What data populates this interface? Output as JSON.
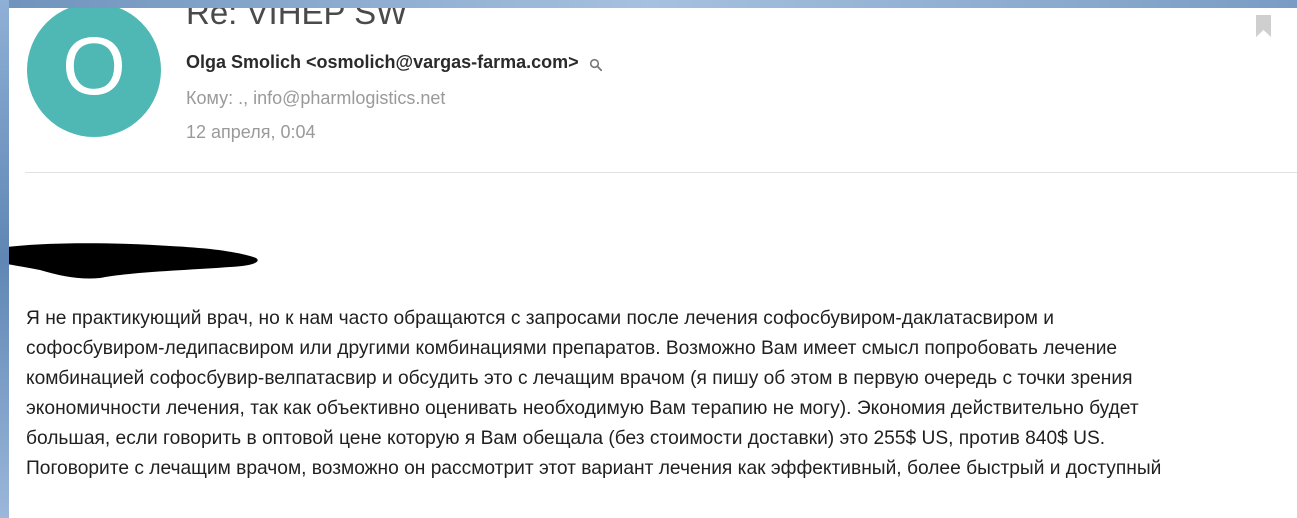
{
  "email": {
    "avatar_letter": "O",
    "subject": "Re: VIHEP SW",
    "sender": "Olga Smolich <osmolich@vargas-farma.com>",
    "to": "Кому: ., info@pharmlogistics.net",
    "date": "12 апреля, 0:04",
    "body_lines": [
      "Я не практикующий врач, но к нам часто обращаются с запросами после лечения софосбувиром-даклатасвиром и",
      "софосбувиром-ледипасвиром или другими комбинациями препаратов. Возможно Вам имеет смысл попробовать лечение",
      "комбинацией софосбувир-велпатасвир и обсудить это с лечащим врачом (я пишу об этом в первую очередь с точки зрения",
      "экономичности лечения, так как объективно оценивать необходимую Вам терапию не могу).  Экономия действительно будет",
      "большая, если говорить в оптовой цене которую я Вам обещала (без стоимости доставки) это 255$ US, против 840$ US.",
      "Поговорите с лечащим врачом, возможно он рассмотрит этот вариант лечения как эффективный, более быстрый и доступный"
    ]
  },
  "icons": {
    "search": "search-icon",
    "bookmark": "bookmark-icon"
  },
  "colors": {
    "avatar": "#4fb8b5",
    "subject": "#4a4a4a",
    "meta": "#9a9a9a",
    "text": "#1f1f1f",
    "bookmark": "#cfcfcf"
  }
}
